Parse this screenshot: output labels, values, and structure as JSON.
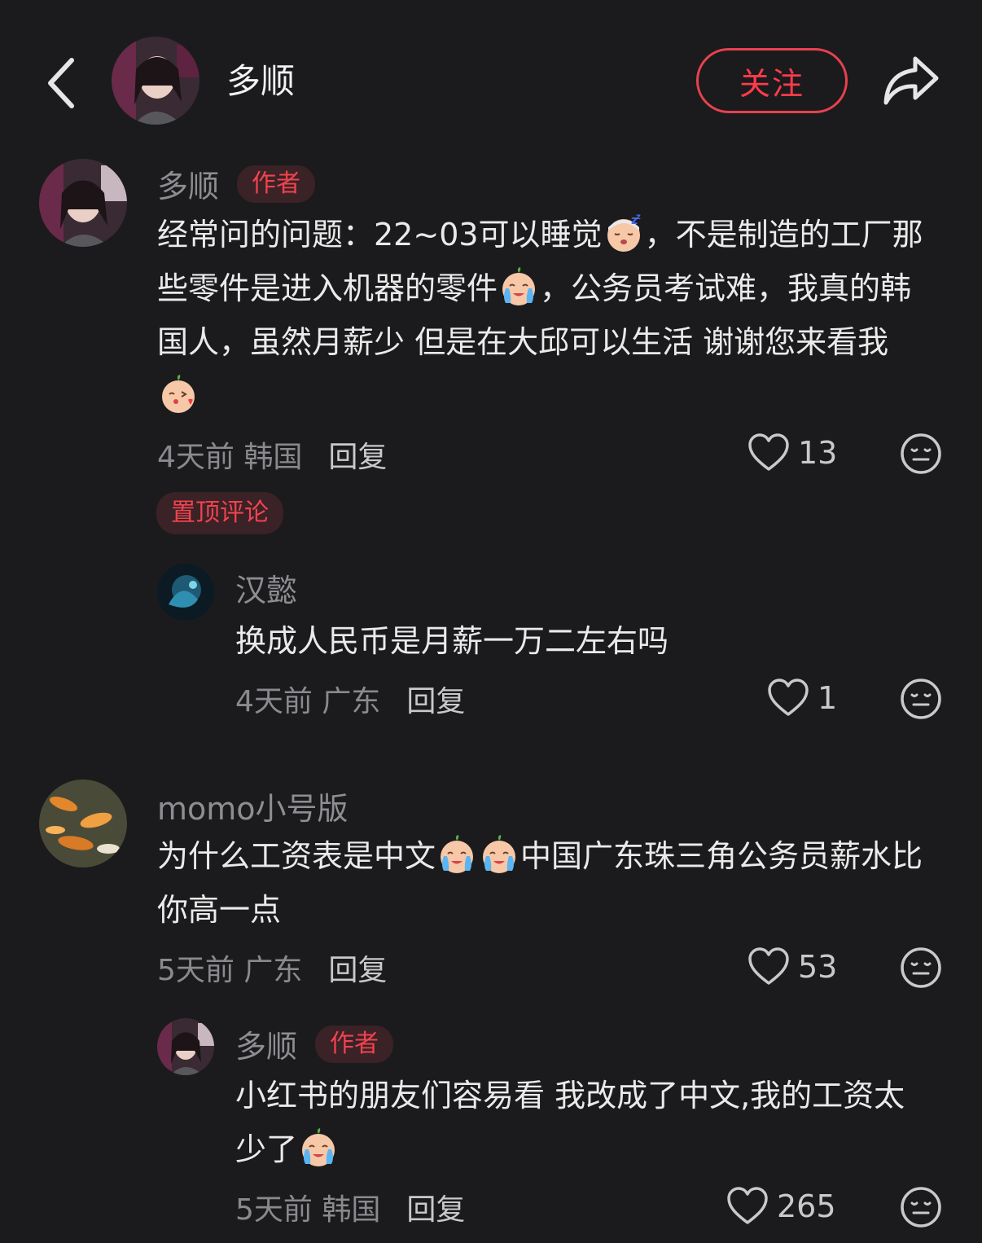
{
  "header": {
    "name": "多顺",
    "follow_label": "关注"
  },
  "tags": {
    "author": "作者",
    "pinned": "置顶评论"
  },
  "comments": [
    {
      "user": "多顺",
      "is_author": true,
      "parts": [
        "经常问的问题：22~03可以睡觉",
        "，不是制造的工厂那些零件是进入机器的零件",
        "，公务员考试难，我真的韩国人，虽然月薪少 但是在大邱可以生活 谢谢您来看我",
        ""
      ],
      "emojis": [
        "sleep-emoji",
        "cry-emoji",
        "kiss-emoji"
      ],
      "time": "4天前 韩国",
      "reply": "回复",
      "likes": "13"
    },
    {
      "user": "汉懿",
      "is_author": false,
      "text": "换成人民币是月薪一万二左右吗",
      "time": "4天前 广东",
      "reply": "回复",
      "likes": "1"
    },
    {
      "user": "momo小号版",
      "is_author": false,
      "parts": [
        "为什么工资表是中文",
        "",
        "中国广东珠三角公务员薪水比你高一点"
      ],
      "emojis": [
        "cry-emoji",
        "cry-emoji"
      ],
      "time": "5天前 广东",
      "reply": "回复",
      "likes": "53"
    },
    {
      "user": "多顺",
      "is_author": true,
      "parts": [
        "小红书的朋友们容易看 我改成了中文,我的工资太少了",
        ""
      ],
      "emojis": [
        "cry-emoji"
      ],
      "time": "5天前 韩国",
      "reply": "回复",
      "likes": "265"
    }
  ],
  "colors": {
    "background": "#1b1b1d",
    "accent": "#ff3b4c",
    "muted": "#8a8a8e"
  }
}
